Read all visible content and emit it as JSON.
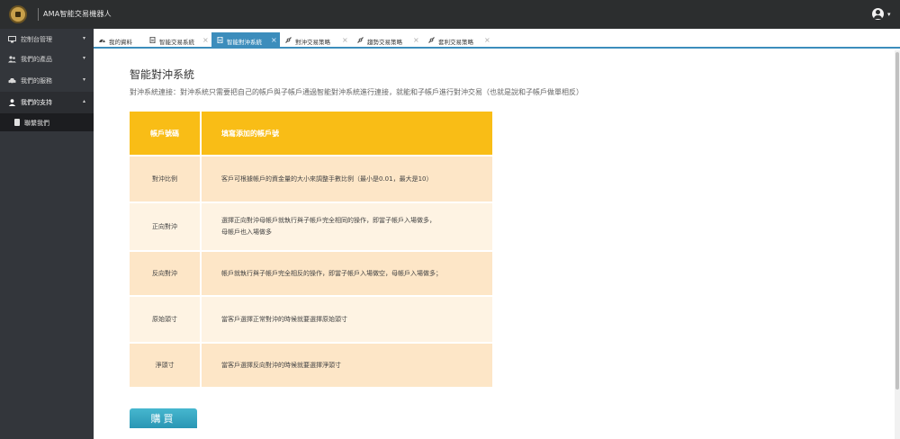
{
  "header": {
    "app_title": "AMA智能交易機器人",
    "user_menu_caret": "▾"
  },
  "sidebar": {
    "items": [
      {
        "label": "控制台管理",
        "icon": "desktop-icon",
        "caret": "▾"
      },
      {
        "label": "我們的產品",
        "icon": "users-icon",
        "caret": "▾"
      },
      {
        "label": "我們的服務",
        "icon": "car-icon",
        "caret": "▾"
      },
      {
        "label": "我們的支持",
        "icon": "user-icon",
        "caret": "▴"
      }
    ],
    "sub_item": {
      "label": "聯繫我們",
      "icon": "file-icon"
    }
  },
  "tabs": [
    {
      "label": "我的資料",
      "icon": "dashboard-icon",
      "close": ""
    },
    {
      "label": "智能交易系統",
      "icon": "file-icon",
      "close": "×"
    },
    {
      "label": "智能對沖系統",
      "icon": "file-icon",
      "close": "×"
    },
    {
      "label": "對沖交易策略",
      "icon": "connect-icon",
      "close": "×"
    },
    {
      "label": "趨勢交易策略",
      "icon": "connect-icon",
      "close": "×"
    },
    {
      "label": "套利交易策略",
      "icon": "connect-icon",
      "close": "×"
    }
  ],
  "main": {
    "title": "智能對沖系統",
    "description": "對沖系統連接：對沖系統只需要把自己的帳戶與子帳戶通過智能對沖系統進行連接，就能和子帳戶進行對沖交易（也就是說和子帳戶做單相反）",
    "table": {
      "header": {
        "col1": "帳戶號碼",
        "col2": "填寫添加的帳戶號"
      },
      "rows": [
        {
          "name": "對沖比例",
          "desc": "客戶可根據帳戶的資金量的大小來調整手數比例（最小是0.01，最大是10）"
        },
        {
          "name": "正向對沖",
          "desc": "選擇正向對沖母帳戶就執行與子帳戶完全相同的操作，即當子帳戶入場做多，",
          "desc2": "母帳戶也入場做多"
        },
        {
          "name": "反向對沖",
          "desc": "帳戶就執行與子帳戶完全相反的操作，即當子帳戶入場做空，母帳戶入場做多；"
        },
        {
          "name": "原始頭寸",
          "desc": "當客戶選擇正常對沖的時候就要選擇原始頭寸"
        },
        {
          "name": "淨頭寸",
          "desc": "當客戶選擇反向對沖的時候就要選擇淨頭寸"
        }
      ]
    },
    "buy_button": "購買"
  },
  "colors": {
    "topbar": "#2c2e2f",
    "sidebar": "#33363b",
    "accent": "#3c8dbc",
    "table_header": "#f9bd16",
    "row_dark": "#fde6c7",
    "row_light": "#fef3e3",
    "buy_button": "#2a96b4"
  }
}
